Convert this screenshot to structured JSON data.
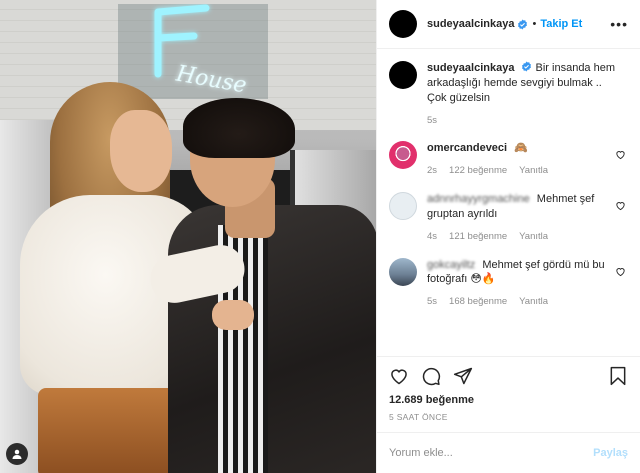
{
  "photo": {
    "alt": "Gönderi fotoğrafı",
    "neon_text": "House",
    "neon_letter": "F",
    "user_tag_icon": "user-tag-icon"
  },
  "header": {
    "username": "sudeyaalcinkaya",
    "separator": "•",
    "follow_label": "Takip Et",
    "more_icon": "more-icon"
  },
  "caption": {
    "username": "sudeyaalcinkaya",
    "text": "Bir insanda hem arkadaşlığı hemde sevgiyi bulmak .. Çok güzelsin",
    "time": "5s"
  },
  "comments": [
    {
      "username": "omercandeveci",
      "text": "🙈",
      "time": "2s",
      "likes": "122 beğenme",
      "reply": "Yanıtla",
      "blurred": false
    },
    {
      "username": "adnnrhayyrgmachine",
      "text": "Mehmet şef gruptan ayrıldı",
      "time": "4s",
      "likes": "121 beğenme",
      "reply": "Yanıtla",
      "blurred": true
    },
    {
      "username": "gokcayiltz",
      "text": "Mehmet şef gördü mü bu fotoğrafı 😳🔥",
      "time": "5s",
      "likes": "168 beğenme",
      "reply": "Yanıtla",
      "blurred": true
    }
  ],
  "actions": {
    "like_icon": "heart-icon",
    "comment_icon": "comment-icon",
    "share_icon": "share-icon",
    "save_icon": "bookmark-icon"
  },
  "likes_count": "12.689 beğenme",
  "timestamp": "5 SAAT ÖNCE",
  "add_comment": {
    "placeholder": "Yorum ekle...",
    "post_label": "Paylaş"
  },
  "colors": {
    "accent": "#0095f6",
    "post_disabled": "#b2dffc",
    "muted": "#8e8e8e",
    "neon": "#9ff3ff"
  }
}
